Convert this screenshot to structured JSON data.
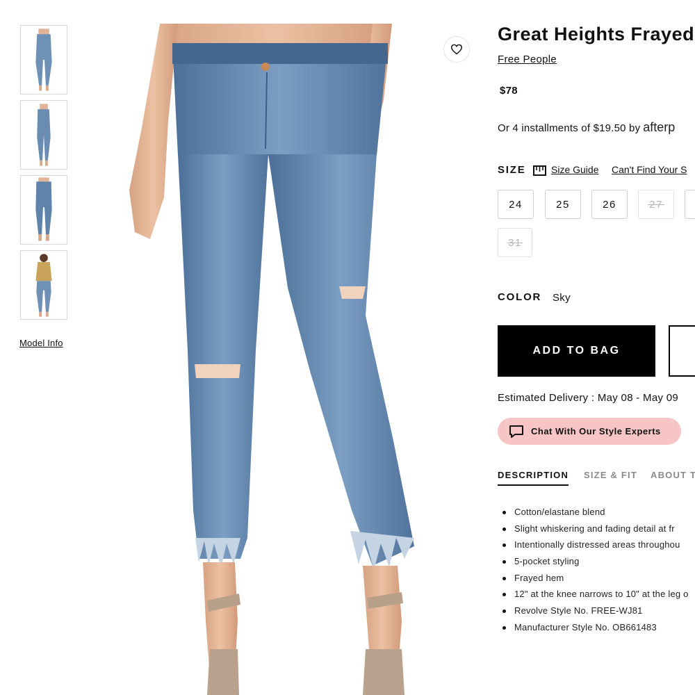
{
  "gallery": {
    "thumbnails": [
      {
        "alt": "front view"
      },
      {
        "alt": "side view"
      },
      {
        "alt": "back view"
      },
      {
        "alt": "full outfit view"
      }
    ],
    "model_info_label": "Model Info"
  },
  "product": {
    "title": "Great Heights Frayed",
    "brand": "Free People",
    "price": "$78",
    "installments_text": "Or 4 installments of $19.50 by",
    "installments_logo": "afterp",
    "wishlist_icon": "heart-icon"
  },
  "size": {
    "label": "SIZE",
    "guide_label": "Size Guide",
    "cant_find_label": "Can't Find Your S",
    "options": [
      {
        "label": "24",
        "available": true
      },
      {
        "label": "25",
        "available": true
      },
      {
        "label": "26",
        "available": true
      },
      {
        "label": "27",
        "available": false
      },
      {
        "label": "",
        "available": true
      },
      {
        "label": "31",
        "available": false
      }
    ]
  },
  "color": {
    "label": "COLOR",
    "value": "Sky"
  },
  "actions": {
    "add_to_bag": "ADD TO BAG"
  },
  "delivery": {
    "text": "Estimated Delivery : May 08 - May 09"
  },
  "chat": {
    "label": "Chat With Our Style Experts"
  },
  "tabs": [
    {
      "label": "DESCRIPTION",
      "active": true
    },
    {
      "label": "SIZE & FIT",
      "active": false
    },
    {
      "label": "ABOUT T",
      "active": false
    }
  ],
  "description": [
    "Cotton/elastane blend",
    "Slight whiskering and fading detail at fr",
    "Intentionally distressed areas throughou",
    "5-pocket styling",
    "Frayed hem",
    "12\" at the knee narrows to 10\" at the leg o",
    "Revolve Style No. FREE-WJ81",
    "Manufacturer Style No. OB661483"
  ],
  "colors": {
    "chat_bg": "#f7c5c5",
    "denim": "#5a7fa6",
    "primary_button": "#000000"
  }
}
